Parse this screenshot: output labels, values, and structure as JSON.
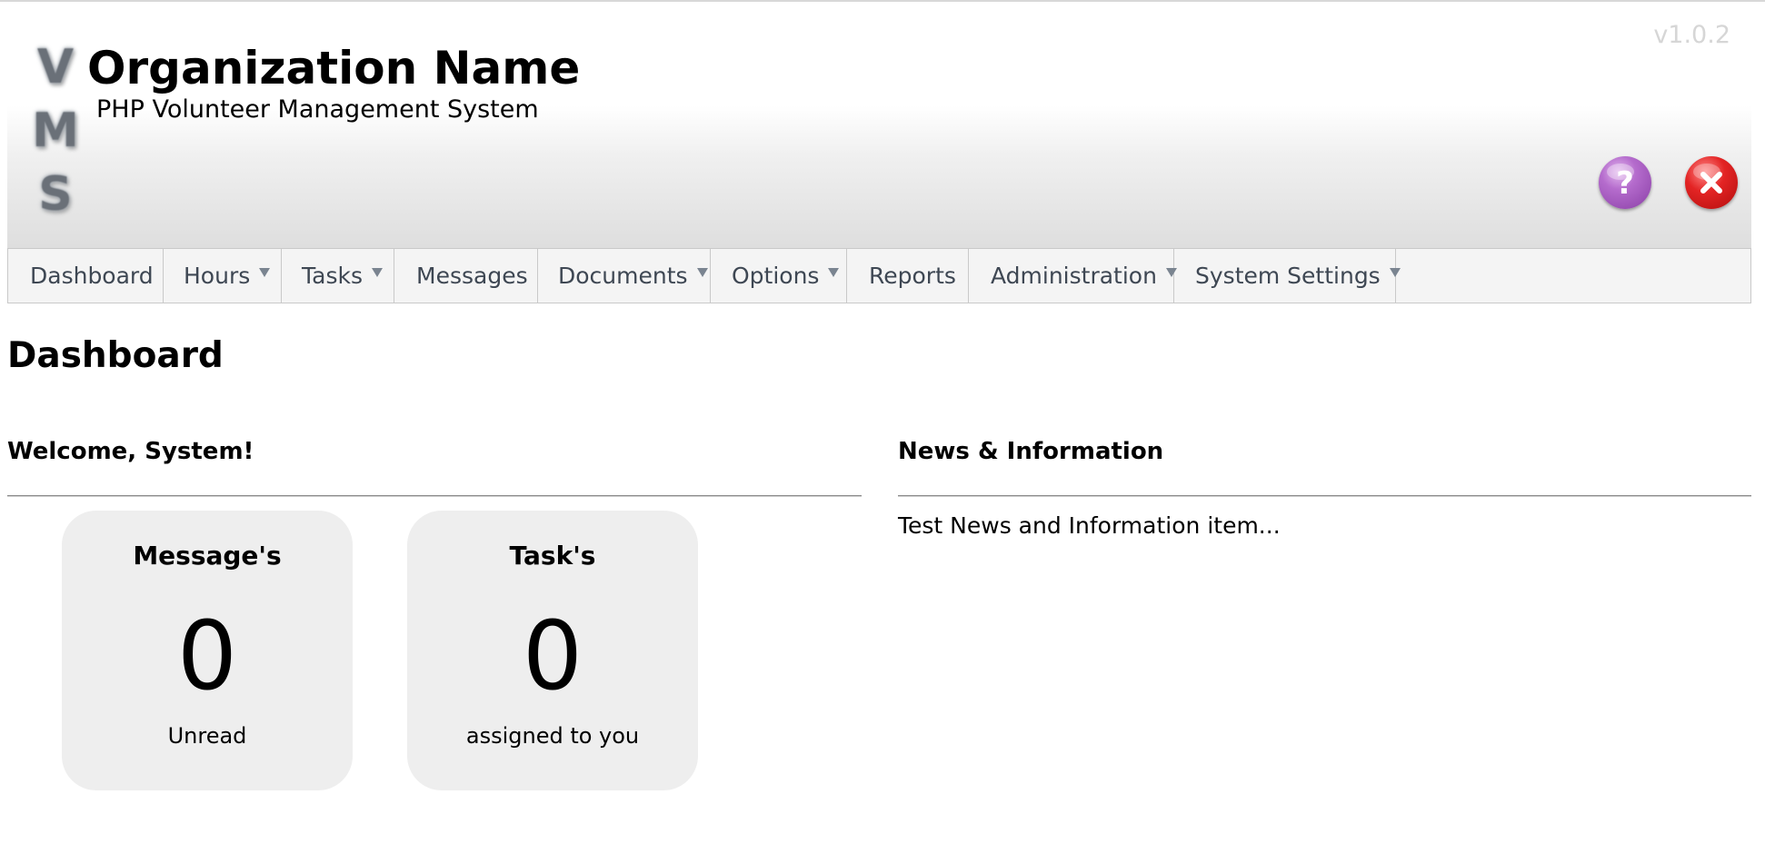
{
  "header": {
    "logo_letters": [
      "V",
      "M",
      "S"
    ],
    "org_name": "Organization Name",
    "subtitle": "PHP Volunteer Management System",
    "version": "v1.0.2",
    "help_icon": "help-question-icon",
    "close_icon": "close-x-icon"
  },
  "nav": {
    "items": [
      {
        "label": "Dashboard",
        "has_dropdown": false
      },
      {
        "label": "Hours",
        "has_dropdown": true
      },
      {
        "label": "Tasks",
        "has_dropdown": true
      },
      {
        "label": "Messages",
        "has_dropdown": false
      },
      {
        "label": "Documents",
        "has_dropdown": true
      },
      {
        "label": "Options",
        "has_dropdown": true
      },
      {
        "label": "Reports",
        "has_dropdown": false
      },
      {
        "label": "Administration",
        "has_dropdown": true
      },
      {
        "label": "System Settings",
        "has_dropdown": true
      }
    ]
  },
  "main": {
    "page_title": "Dashboard",
    "welcome": {
      "heading": "Welcome, System!",
      "cards": [
        {
          "title": "Message's",
          "count": "0",
          "caption": "Unread"
        },
        {
          "title": "Task's",
          "count": "0",
          "caption": "assigned to you"
        }
      ]
    },
    "news": {
      "heading": "News & Information",
      "items": [
        "Test News and Information item..."
      ]
    }
  },
  "colors": {
    "nav_text": "#3e4753",
    "nav_background": "#f4f4f4",
    "card_background": "#eeeeee",
    "help_button": "#a855c7",
    "close_button": "#e32424",
    "version_text": "#d6d6d6"
  }
}
